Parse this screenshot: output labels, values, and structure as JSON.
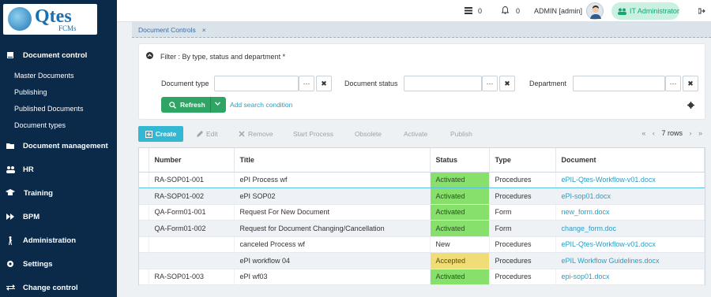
{
  "app": {
    "logo_text": "Qtes",
    "logo_sub": "FCMs"
  },
  "sidebar": {
    "items": [
      {
        "label": "Document control",
        "icon": "book-icon"
      },
      {
        "label": "Document management",
        "icon": "folder-icon"
      },
      {
        "label": "HR",
        "icon": "users-icon"
      },
      {
        "label": "Training",
        "icon": "graduation-cap-icon"
      },
      {
        "label": "BPM",
        "icon": "fast-forward-icon"
      },
      {
        "label": "Administration",
        "icon": "person-walking-icon"
      },
      {
        "label": "Settings",
        "icon": "gear-icon"
      },
      {
        "label": "Change control",
        "icon": "exchange-icon"
      }
    ],
    "subitems": [
      "Master Documents",
      "Publishing",
      "Published Documents",
      "Document types"
    ]
  },
  "topbar": {
    "tasks_count": "0",
    "notif_count": "0",
    "user": "ADMIN [admin]",
    "role": "IT Administrator"
  },
  "tab": {
    "label": "Document Controls",
    "close": "×"
  },
  "filter": {
    "title": "Filter : By type, status and department *",
    "doc_type_label": "Document type",
    "doc_status_label": "Document status",
    "department_label": "Department",
    "ellipsis": "···",
    "clear": "✖",
    "refresh_label": "Refresh",
    "add_condition": "Add search condition"
  },
  "toolbar": {
    "create": "Create",
    "edit": "Edit",
    "remove": "Remove",
    "start_process": "Start Process",
    "obsolete": "Obsolete",
    "activate": "Activate",
    "publish": "Publish",
    "rows": "7 rows"
  },
  "colors": {
    "sidebar": "#0b2a4a",
    "activated": "#86e06b",
    "accepted": "#f1dd76",
    "accent": "#33b8d4",
    "green": "#2fa565"
  },
  "table": {
    "headers": [
      "Number",
      "Title",
      "Status",
      "Type",
      "Document"
    ],
    "rows": [
      {
        "number": "RA-SOP01-001",
        "title": "ePI Process wf",
        "status": "Activated",
        "type": "Procedures",
        "document": "ePIL-Qtes-Workflow-v01.docx"
      },
      {
        "number": "RA-SOP01-002",
        "title": "ePI SOP02",
        "status": "Activated",
        "type": "Procedures",
        "document": "ePI-sop01.docx"
      },
      {
        "number": "QA-Form01-001",
        "title": "Request For New Document",
        "status": "Activated",
        "type": "Form",
        "document": "new_form.docx"
      },
      {
        "number": "QA-Form01-002",
        "title": "Request for Document Changing/Cancellation",
        "status": "Activated",
        "type": "Form",
        "document": "change_form.doc"
      },
      {
        "number": "",
        "title": "canceled Process wf",
        "status": "New",
        "type": "Procedures",
        "document": "ePIL-Qtes-Workflow-v01.docx"
      },
      {
        "number": "",
        "title": "ePI workflow 04",
        "status": "Accepted",
        "type": "Procedures",
        "document": "ePIL Workflow Guidelines.docx"
      },
      {
        "number": "RA-SOP01-003",
        "title": "ePI wf03",
        "status": "Activated",
        "type": "Procedures",
        "document": "epi-sop01.docx"
      }
    ]
  }
}
